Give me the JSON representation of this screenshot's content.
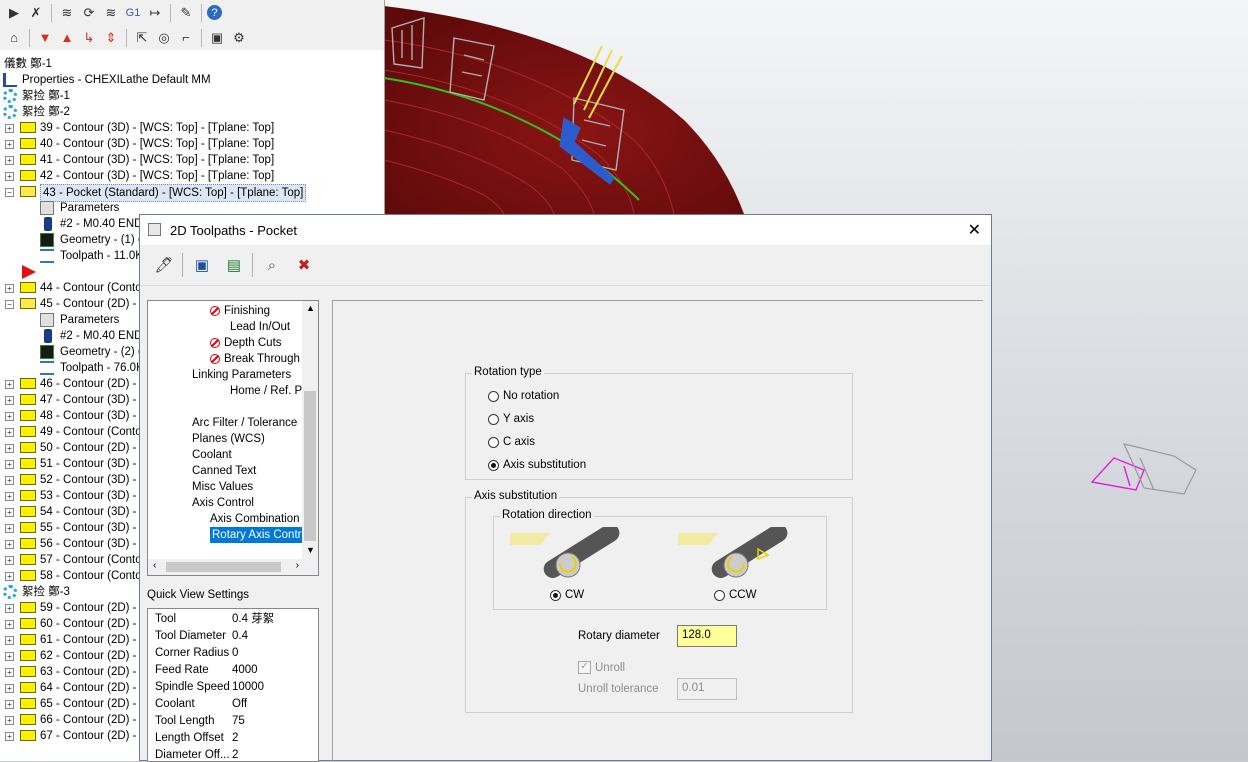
{
  "toolbar_row1_icons": [
    "select-all-icon",
    "deselect-icon",
    "regen-icon",
    "regen-dirty-icon",
    "regen-all-icon",
    "g1-icon",
    "backplot-icon",
    "verify-icon",
    "help-icon"
  ],
  "toolbar_row1_g1": "G1",
  "tree": {
    "root_a": "儀數  鄭-1",
    "properties": "Properties - CHEXILathe Default MM",
    "group1": "絮捡  鄭-1",
    "group2": "絮捡  鄭-2",
    "items_a": [
      "39 - Contour (3D) - [WCS: Top] - [Tplane: Top]",
      "40 - Contour (3D) - [WCS: Top] - [Tplane: Top]",
      "41 - Contour (3D) - [WCS: Top] - [Tplane: Top]",
      "42 - Contour (3D) - [WCS: Top] - [Tplane: Top]"
    ],
    "item_43": "43 - Pocket (Standard) - [WCS: Top] - [Tplane: Top]",
    "sub43": [
      "Parameters",
      "#2 - M0.40 END",
      "Geometry - (1) c",
      "Toolpath - 11.0K"
    ],
    "item_44": "44 - Contour (Conto",
    "item_45": "45 - Contour (2D) - [",
    "sub45": [
      "Parameters",
      "#2 - M0.40 ENDI",
      "Geometry - (2) c",
      "Toolpath - 76.0K"
    ],
    "items_b": [
      "46 - Contour (2D) - [",
      "47 - Contour (3D) - [",
      "48 - Contour (3D) - [",
      "49 - Contour (Conto",
      "50 - Contour (2D) - [",
      "51 - Contour (3D) - [",
      "52 - Contour (3D) - [",
      "53 - Contour (3D) - [",
      "54 - Contour (3D) - [",
      "55 - Contour (3D) - [",
      "56 - Contour (3D) - [",
      "57 - Contour (Conto",
      "58 - Contour (Conto"
    ],
    "group3": "絮捡  鄭-3",
    "items_c": [
      "59 - Contour (2D) - [",
      "60 - Contour (2D) - [",
      "61 - Contour (2D) - [",
      "62 - Contour (2D) - [",
      "63 - Contour (2D) - [",
      "64 - Contour (2D) - [",
      "65 - Contour (2D) - [",
      "66 - Contour (2D) - [",
      "67 - Contour (2D) - ["
    ]
  },
  "dialog": {
    "title": "2D Toolpaths - Pocket",
    "close": "✕",
    "param_tree": [
      {
        "label": "Finishing",
        "icon": true
      },
      {
        "label": "Lead In/Out",
        "icon": false
      },
      {
        "label": "Depth Cuts",
        "icon": true
      },
      {
        "label": "Break Through",
        "icon": true
      },
      {
        "label": "Linking Parameters",
        "icon": false
      },
      {
        "label": "Home / Ref. Points",
        "icon": false
      },
      {
        "label": "",
        "icon": false
      },
      {
        "label": "Arc Filter / Tolerance",
        "icon": false
      },
      {
        "label": "Planes (WCS)",
        "icon": false
      },
      {
        "label": "Coolant",
        "icon": false
      },
      {
        "label": "Canned Text",
        "icon": false
      },
      {
        "label": "Misc Values",
        "icon": false
      },
      {
        "label": "Axis Control",
        "icon": false
      },
      {
        "label": "Axis Combination",
        "icon": false
      },
      {
        "label": "Rotary Axis Control",
        "icon": false
      }
    ],
    "quick_view_title": "Quick View Settings",
    "quick_view": [
      {
        "k": "Tool",
        "v": "0.4    芽絮"
      },
      {
        "k": "Tool Diameter",
        "v": "0.4"
      },
      {
        "k": "Corner Radius",
        "v": "0"
      },
      {
        "k": "Feed Rate",
        "v": "4000"
      },
      {
        "k": "Spindle Speed",
        "v": "10000"
      },
      {
        "k": "Coolant",
        "v": "Off"
      },
      {
        "k": "Tool Length",
        "v": "75"
      },
      {
        "k": "Length Offset",
        "v": "2"
      },
      {
        "k": "Diameter Off...",
        "v": "2"
      }
    ],
    "rotation_type": {
      "title": "Rotation type",
      "options": [
        "No rotation",
        "Y axis",
        "C axis",
        "Axis substitution"
      ],
      "selected": 3
    },
    "axis_sub": {
      "title": "Axis substitution",
      "dir_title": "Rotation direction",
      "cw": "CW",
      "ccw": "CCW",
      "selected": "CW",
      "rotary_diameter_label": "Rotary diameter",
      "rotary_diameter": "128.0",
      "unroll_label": "Unroll",
      "unroll_checked": true,
      "unroll_tol_label": "Unroll tolerance",
      "unroll_tol": "0.01"
    }
  },
  "colors": {
    "accent": "#0078d7",
    "field_highlight": "#ffff99",
    "part_red": "#7a1010",
    "toolpath_green": "#2ec21b",
    "magenta": "#e020e0"
  }
}
